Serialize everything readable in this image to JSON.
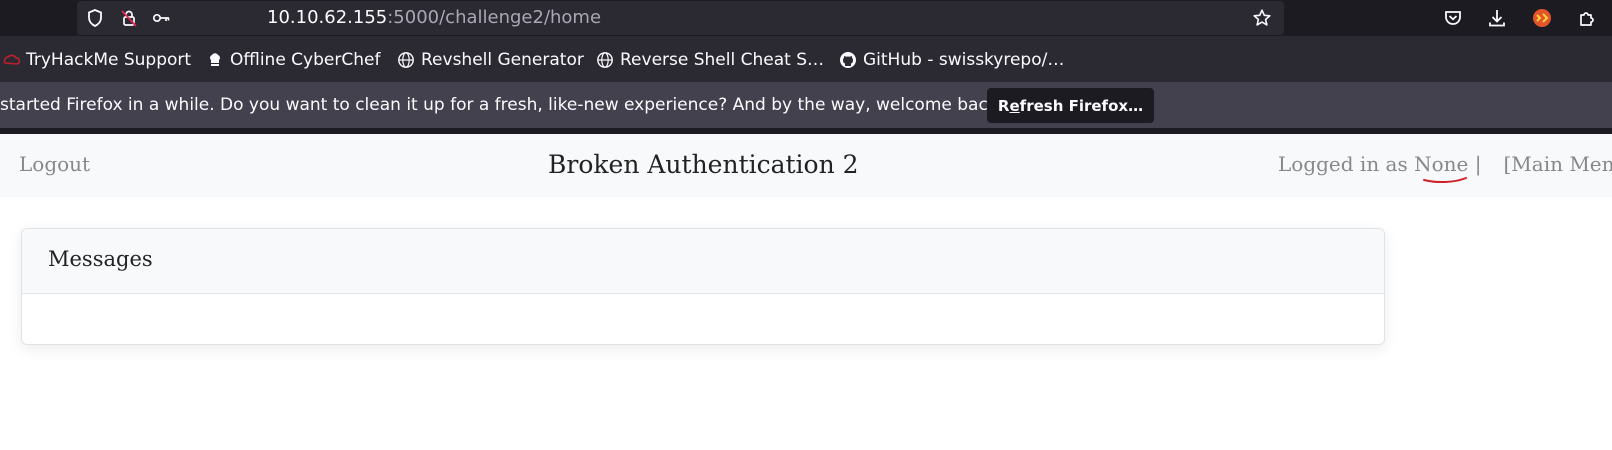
{
  "browser": {
    "url_host": "10.10.62.155",
    "url_path": ":5000/challenge2/home",
    "bookmarks": [
      {
        "label": "TryHackMe Support",
        "icon": "tryhackme-icon"
      },
      {
        "label": "Offline CyberChef",
        "icon": "chef-hat-icon"
      },
      {
        "label": "Revshell Generator",
        "icon": "globe-icon"
      },
      {
        "label": "Reverse Shell Cheat S…",
        "icon": "globe-icon"
      },
      {
        "label": "GitHub - swisskyrepo/…",
        "icon": "github-icon"
      }
    ],
    "notification": {
      "message": "started Firefox in a while. Do you want to clean it up for a fresh, like-new experience? And by the way, welcome back!",
      "button_prefix": "R",
      "button_accel": "e",
      "button_suffix": "fresh Firefox…"
    }
  },
  "navbar": {
    "logout": "Logout",
    "brand": "Broken Authentication 2",
    "logged_in_prefix": "Logged in as ",
    "user": "None",
    "separator": " |",
    "main_menu": "[Main Men"
  },
  "card": {
    "title": "Messages"
  },
  "colors": {
    "chrome_dark": "#1c1b22",
    "chrome_mid": "#2b2a33",
    "notification_bg": "#42414d",
    "annotation_red": "#d0202a"
  }
}
